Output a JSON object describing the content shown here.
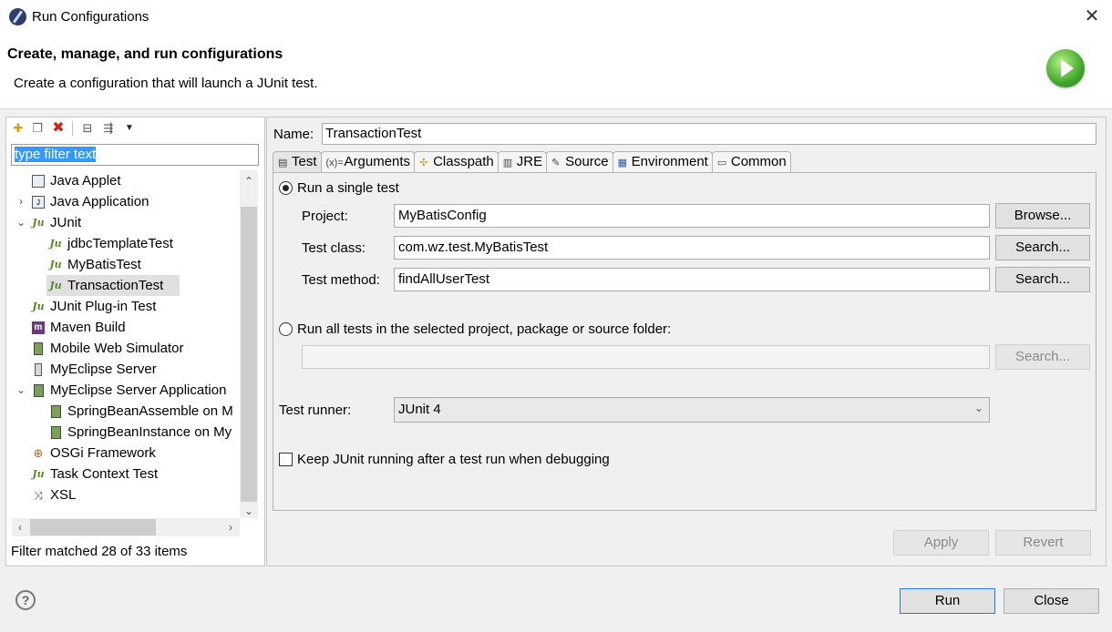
{
  "window": {
    "title": "Run Configurations",
    "close_glyph": "✕"
  },
  "banner": {
    "title": "Create, manage, and run configurations",
    "subtitle": "Create a configuration that will launch a JUnit test."
  },
  "left": {
    "filter_placeholder": "type filter text",
    "tree": [
      {
        "label": "Java Applet",
        "icon": "applet-icon",
        "expanded": null
      },
      {
        "label": "Java Application",
        "icon": "java-app-icon",
        "expanded": false
      },
      {
        "label": "JUnit",
        "icon": "junit-icon",
        "expanded": true
      },
      {
        "label": "jdbcTemplateTest",
        "icon": "junit-icon",
        "child": true
      },
      {
        "label": "MyBatisTest",
        "icon": "junit-icon",
        "child": true
      },
      {
        "label": "TransactionTest",
        "icon": "junit-icon",
        "child": true,
        "selected": true
      },
      {
        "label": "JUnit Plug-in Test",
        "icon": "junit-plugin-icon"
      },
      {
        "label": "Maven Build",
        "icon": "maven-icon"
      },
      {
        "label": "Mobile Web Simulator",
        "icon": "mobile-icon"
      },
      {
        "label": "MyEclipse Server",
        "icon": "server-icon"
      },
      {
        "label": "MyEclipse Server Application",
        "icon": "server-app-icon",
        "expanded": true
      },
      {
        "label": "SpringBeanAssemble on M",
        "icon": "server-app-icon",
        "child": true
      },
      {
        "label": "SpringBeanInstance on My",
        "icon": "server-app-icon",
        "child": true
      },
      {
        "label": "OSGi Framework",
        "icon": "osgi-icon"
      },
      {
        "label": "Task Context Test",
        "icon": "task-context-icon"
      },
      {
        "label": "XSL",
        "icon": "xsl-icon"
      }
    ],
    "status": "Filter matched 28 of 33 items"
  },
  "right": {
    "name_label": "Name:",
    "name_value": "TransactionTest",
    "tabs": [
      "Test",
      "Arguments",
      "Classpath",
      "JRE",
      "Source",
      "Environment",
      "Common"
    ],
    "single_test_label": "Run a single test",
    "project_label": "Project:",
    "project_value": "MyBatisConfig",
    "browse_label": "Browse...",
    "test_class_label": "Test class:",
    "test_class_value": "com.wz.test.MyBatisTest",
    "search_label": "Search...",
    "test_method_label": "Test method:",
    "test_method_value": "findAllUserTest",
    "all_tests_label": "Run all tests in the selected project, package or source folder:",
    "runner_label": "Test runner:",
    "runner_value": "JUnit 4",
    "keep_running_label": "Keep JUnit running after a test run when debugging",
    "apply_label": "Apply",
    "revert_label": "Revert"
  },
  "footer": {
    "run_label": "Run",
    "close_label": "Close",
    "help_glyph": "?"
  }
}
